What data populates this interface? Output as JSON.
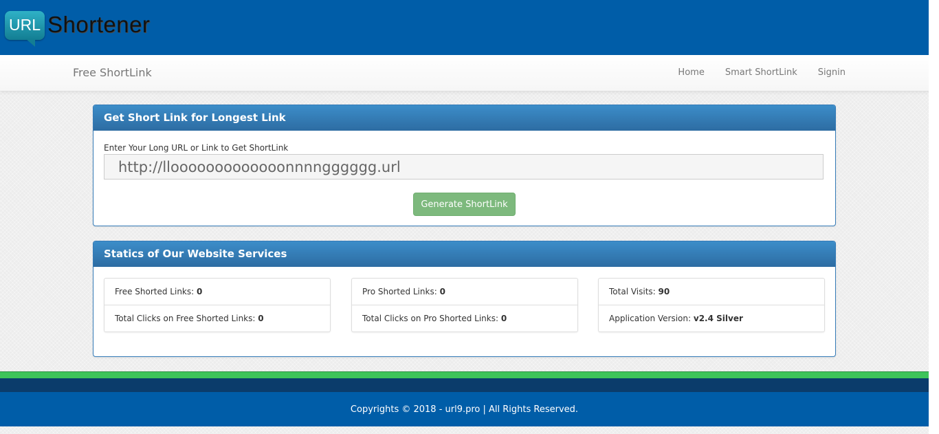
{
  "logo": {
    "bubble_text": "URL",
    "wordmark": "Shortener"
  },
  "navbar": {
    "brand": "Free ShortLink",
    "links": [
      "Home",
      "Smart ShortLink",
      "Signin"
    ]
  },
  "shortener_panel": {
    "heading": "Get Short Link for Longest Link",
    "input_label": "Enter Your Long URL or Link to Get ShortLink",
    "input_placeholder": "http://llooooooooooooonnnngggggg.url",
    "button_label": "Generate ShortLink"
  },
  "stats_panel": {
    "heading": "Statics of Our Website Services",
    "boxes": [
      {
        "rows": [
          {
            "label": "Free Shorted Links:",
            "value": "0"
          },
          {
            "label": "Total Clicks on Free Shorted Links:",
            "value": "0"
          }
        ]
      },
      {
        "rows": [
          {
            "label": "Pro Shorted Links:",
            "value": "0"
          },
          {
            "label": "Total Clicks on Pro Shorted Links:",
            "value": "0"
          }
        ]
      },
      {
        "rows": [
          {
            "label": "Total Visits:",
            "value": "90"
          },
          {
            "label": "Application Version:",
            "value": "v2.4 Silver"
          }
        ]
      }
    ]
  },
  "footer": {
    "text": "Copyrights © 2018 - url9.pro | All Rights Reserved."
  },
  "colors": {
    "header_blue": "#005da8",
    "panel_blue": "#337ab7",
    "button_green": "#7db97d",
    "stripe_green": "#3ec45a"
  }
}
